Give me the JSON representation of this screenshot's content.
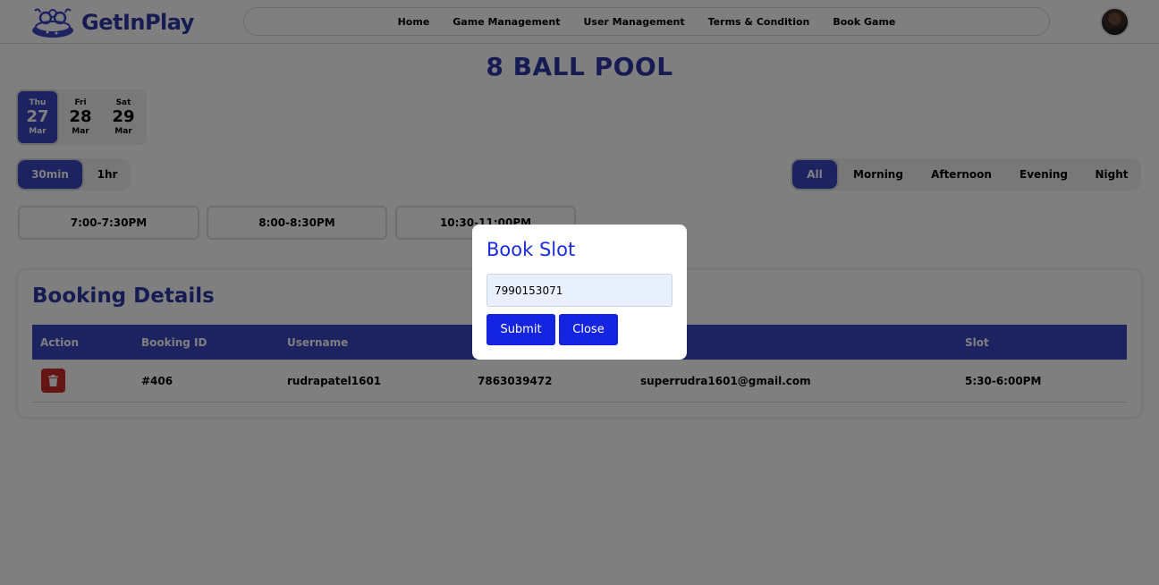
{
  "brand": {
    "name": "GetInPlay"
  },
  "nav": {
    "links": [
      "Home",
      "Game Management",
      "User Management",
      "Terms & Condition",
      "Book Game"
    ]
  },
  "game": {
    "title": "8 BALL POOL"
  },
  "dates": [
    {
      "dow": "Thu",
      "day": "27",
      "month": "Mar",
      "selected": true
    },
    {
      "dow": "Fri",
      "day": "28",
      "month": "Mar",
      "selected": false
    },
    {
      "dow": "Sat",
      "day": "29",
      "month": "Mar",
      "selected": false
    }
  ],
  "durations": [
    {
      "label": "30min",
      "selected": true
    },
    {
      "label": "1hr",
      "selected": false
    }
  ],
  "periods": [
    {
      "label": "All",
      "selected": true
    },
    {
      "label": "Morning",
      "selected": false
    },
    {
      "label": "Afternoon",
      "selected": false
    },
    {
      "label": "Evening",
      "selected": false
    },
    {
      "label": "Night",
      "selected": false
    }
  ],
  "slots": [
    "7:00-7:30PM",
    "8:00-8:30PM",
    "10:30-11:00PM"
  ],
  "booking": {
    "title": "Booking Details",
    "columns": [
      "Action",
      "Booking ID",
      "Username",
      "",
      "",
      "Slot"
    ],
    "rows": [
      {
        "booking_id": "#406",
        "username": "rudrapatel1601",
        "phone": "7863039472",
        "email": "superrudra1601@gmail.com",
        "slot": "5:30-6:00PM"
      }
    ]
  },
  "modal": {
    "title": "Book Slot",
    "input_value": "7990153071",
    "submit_label": "Submit",
    "close_label": "Close"
  },
  "colors": {
    "brand": "#2c36a6",
    "accent": "#3a44c2",
    "modal_button": "#1424e0",
    "danger": "#cc2a2a",
    "overlay": "rgba(0,0,0,0.5)"
  }
}
